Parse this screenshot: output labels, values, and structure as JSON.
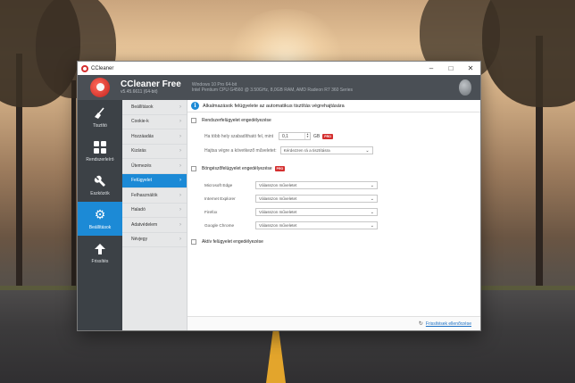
{
  "window": {
    "title": "CCleaner"
  },
  "header": {
    "product_name": "CCleaner Free",
    "version": "v5.45.6611 (64-bit)",
    "sysinfo_line1": "Windows 10 Pro 64-bit",
    "sysinfo_line2": "Intel Pentium CPU G4560 @ 3.50GHz, 8,0GB RAM, AMD Radeon R7 360 Series"
  },
  "leftnav": {
    "items": [
      {
        "label": "Tisztító",
        "icon": "broom-icon"
      },
      {
        "label": "Rendszerleíró",
        "icon": "registry-grid-icon"
      },
      {
        "label": "Eszközök",
        "icon": "wrench-icon"
      },
      {
        "label": "Beállítások",
        "icon": "gear-icon",
        "active": true
      },
      {
        "label": "Frissítés",
        "icon": "arrow-up-icon"
      }
    ]
  },
  "subnav": {
    "items": [
      {
        "label": "Beállítások"
      },
      {
        "label": "Cookie-k"
      },
      {
        "label": "Hozzáadás"
      },
      {
        "label": "Kizárás"
      },
      {
        "label": "Ütemezés"
      },
      {
        "label": "Felügyelet",
        "active": true
      },
      {
        "label": "Felhasználók"
      },
      {
        "label": "Haladó"
      },
      {
        "label": "Adatvédelem"
      },
      {
        "label": "Névjegy"
      }
    ]
  },
  "main": {
    "info_text": "Alkalmazások felügyelete az automatikus tisztítás végrehajtására",
    "system_monitoring_label": "Rendszerfelügyelet engedélyezése",
    "threshold_label": "Ha több hely szabadítható fel, mint",
    "threshold_value": "0,1",
    "threshold_unit": "GB",
    "pro_badge": "PRO",
    "action_label": "Hajtsa végre a következő műveletet:",
    "action_value": "Kérdezzen rá a tisztításra",
    "browser_monitoring_label": "Böngészőfelügyelet engedélyezése",
    "browsers": [
      {
        "name": "Microsoft Edge",
        "value": "Válasszon műveletet"
      },
      {
        "name": "Internet Explorer",
        "value": "Válasszon műveletet"
      },
      {
        "name": "Firefox",
        "value": "Válasszon műveletet"
      },
      {
        "name": "Google Chrome",
        "value": "Válasszon műveletet"
      }
    ],
    "active_monitoring_label": "Aktív felügyelet engedélyezése"
  },
  "footer": {
    "update_link": "Frissítések ellenőrzése"
  }
}
